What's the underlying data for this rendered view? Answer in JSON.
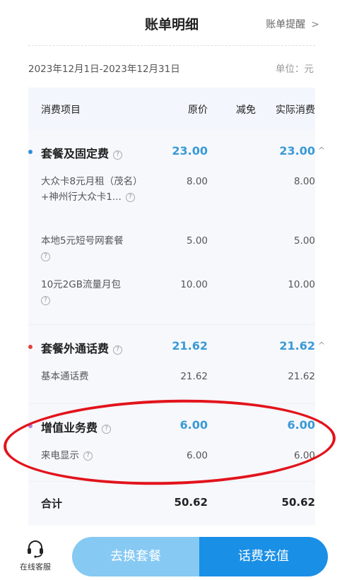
{
  "header": {
    "title": "账单明细",
    "reminder_label": "账单提醒",
    "chevron": ">"
  },
  "period": {
    "range": "2023年12月1日-2023年12月31日",
    "unit": "单位：元"
  },
  "table": {
    "columns": [
      "消费项目",
      "原价",
      "减免",
      "实际消费"
    ],
    "sections": [
      {
        "title": "套餐及固定费",
        "original": "23.00",
        "actual": "23.00",
        "dot_color": "#2f8fd8",
        "items": [
          {
            "name": "大众卡8元月租（茂名）+神州行大众卡1...",
            "original": "8.00",
            "actual": "8.00"
          },
          {
            "name": "本地5元短号网套餐",
            "original": "5.00",
            "actual": "5.00"
          },
          {
            "name": "10元2GB流量月包",
            "original": "10.00",
            "actual": "10.00"
          }
        ]
      },
      {
        "title": "套餐外通话费",
        "original": "21.62",
        "actual": "21.62",
        "dot_color": "#e0423a",
        "items": [
          {
            "name": "基本通话费",
            "original": "21.62",
            "actual": "21.62"
          }
        ]
      },
      {
        "title": "增值业务费",
        "original": "6.00",
        "actual": "6.00",
        "dot_color": "#b57fd9",
        "items": [
          {
            "name": "来电显示",
            "original": "6.00",
            "actual": "6.00"
          }
        ]
      }
    ],
    "total": {
      "label": "合计",
      "original": "50.62",
      "actual": "50.62"
    }
  },
  "bottom": {
    "service_label": "在线客服",
    "change_plan_label": "去换套餐",
    "recharge_label": "话费充值"
  },
  "colors": {
    "accent": "#3a9ad6",
    "primary_button": "#1a8fe6",
    "secondary_button": "#86c9f3",
    "highlight_ring": "#e3131b"
  }
}
